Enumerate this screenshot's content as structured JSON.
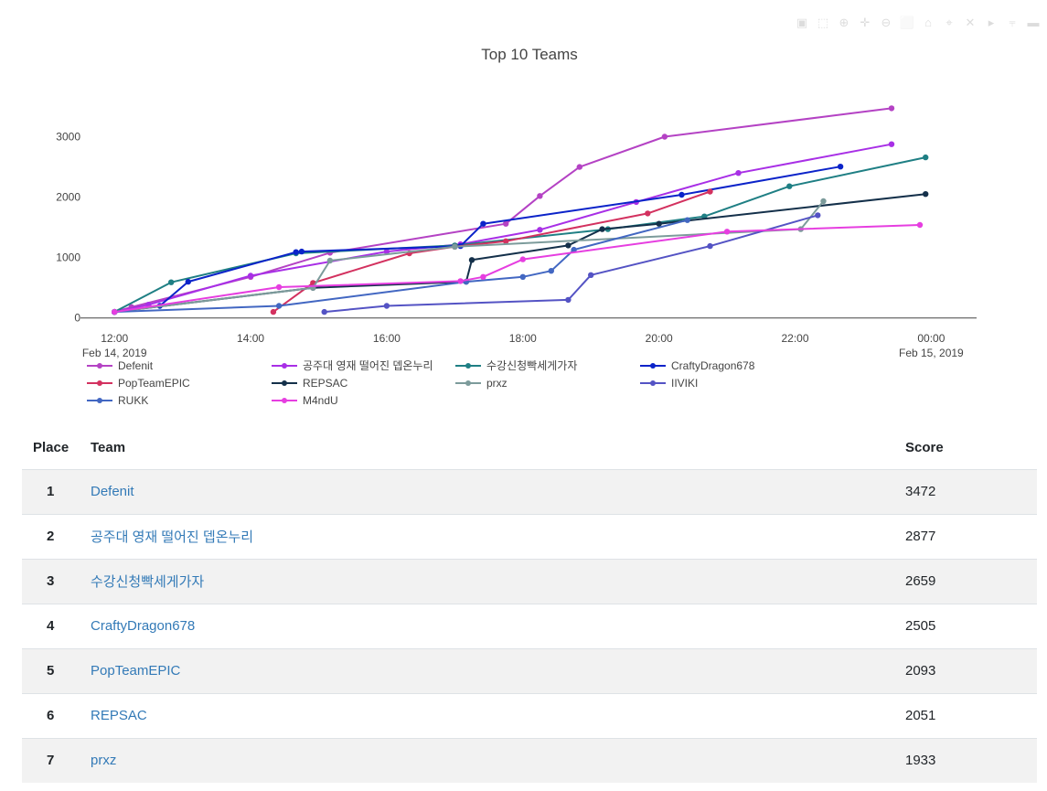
{
  "modebar": {
    "icons": [
      "camera-icon",
      "zoom-icon",
      "zoom-in-icon",
      "pan-icon",
      "zoom-out-icon",
      "autoscale-icon",
      "reset-axes-icon",
      "home-icon",
      "spike-icon",
      "hover-closest-icon",
      "hover-compare-icon",
      "plotly-logo-icon"
    ]
  },
  "chart_data": {
    "type": "line",
    "title": "Top 10 Teams",
    "xlabel": "",
    "ylabel": "",
    "x_type": "datetime",
    "x_range": [
      "2019-02-14 11:30",
      "2019-02-15 00:40"
    ],
    "ylim": [
      -80,
      3750
    ],
    "grid": false,
    "legend_position": "bottom",
    "x_ticks": [
      {
        "t": "2019-02-14 12:00",
        "line1": "12:00",
        "line2": "Feb 14, 2019"
      },
      {
        "t": "2019-02-14 14:00",
        "line1": "14:00",
        "line2": ""
      },
      {
        "t": "2019-02-14 16:00",
        "line1": "16:00",
        "line2": ""
      },
      {
        "t": "2019-02-14 18:00",
        "line1": "18:00",
        "line2": ""
      },
      {
        "t": "2019-02-14 20:00",
        "line1": "20:00",
        "line2": ""
      },
      {
        "t": "2019-02-14 22:00",
        "line1": "22:00",
        "line2": ""
      },
      {
        "t": "2019-02-15 00:00",
        "line1": "00:00",
        "line2": "Feb 15, 2019"
      }
    ],
    "y_ticks": [
      0,
      1000,
      2000,
      3000
    ],
    "series": [
      {
        "name": "Defenit",
        "color": "#b442c4",
        "points": [
          [
            "2019-02-14 12:00",
            100
          ],
          [
            "2019-02-14 12:15",
            180
          ],
          [
            "2019-02-14 14:00",
            680
          ],
          [
            "2019-02-14 15:10",
            1080
          ],
          [
            "2019-02-14 17:45",
            1560
          ],
          [
            "2019-02-14 18:15",
            2020
          ],
          [
            "2019-02-14 18:50",
            2500
          ],
          [
            "2019-02-14 20:05",
            3000
          ],
          [
            "2019-02-14 23:25",
            3472
          ]
        ]
      },
      {
        "name": "공주대 영재 떨어진 뎁온누리",
        "color": "#a82fe6",
        "points": [
          [
            "2019-02-14 12:00",
            100
          ],
          [
            "2019-02-14 12:30",
            220
          ],
          [
            "2019-02-14 14:00",
            700
          ],
          [
            "2019-02-14 16:00",
            1100
          ],
          [
            "2019-02-14 17:05",
            1220
          ],
          [
            "2019-02-14 18:15",
            1460
          ],
          [
            "2019-02-14 19:40",
            1920
          ],
          [
            "2019-02-14 21:10",
            2400
          ],
          [
            "2019-02-14 23:25",
            2877
          ]
        ]
      },
      {
        "name": "수강신청빡세게가자",
        "color": "#1f7f84",
        "points": [
          [
            "2019-02-14 12:00",
            100
          ],
          [
            "2019-02-14 12:50",
            590
          ],
          [
            "2019-02-14 14:40",
            1070
          ],
          [
            "2019-02-14 17:00",
            1200
          ],
          [
            "2019-02-14 19:15",
            1470
          ],
          [
            "2019-02-14 20:40",
            1680
          ],
          [
            "2019-02-14 21:55",
            2180
          ],
          [
            "2019-02-14 23:55",
            2659
          ]
        ]
      },
      {
        "name": "CraftyDragon678",
        "color": "#0b23c9",
        "points": [
          [
            "2019-02-14 12:00",
            100
          ],
          [
            "2019-02-14 12:40",
            200
          ],
          [
            "2019-02-14 13:05",
            600
          ],
          [
            "2019-02-14 14:40",
            1090
          ],
          [
            "2019-02-14 14:45",
            1100
          ],
          [
            "2019-02-14 17:05",
            1190
          ],
          [
            "2019-02-14 17:25",
            1560
          ],
          [
            "2019-02-14 20:20",
            2040
          ],
          [
            "2019-02-14 22:40",
            2505
          ]
        ]
      },
      {
        "name": "PopTeamEPIC",
        "color": "#d3315f",
        "points": [
          [
            "2019-02-14 14:20",
            100
          ],
          [
            "2019-02-14 14:55",
            580
          ],
          [
            "2019-02-14 16:20",
            1070
          ],
          [
            "2019-02-14 17:00",
            1180
          ],
          [
            "2019-02-14 17:45",
            1270
          ],
          [
            "2019-02-14 19:50",
            1730
          ],
          [
            "2019-02-14 20:45",
            2093
          ]
        ]
      },
      {
        "name": "REPSAC",
        "color": "#14304a",
        "points": [
          [
            "2019-02-14 12:00",
            100
          ],
          [
            "2019-02-14 14:55",
            500
          ],
          [
            "2019-02-14 17:10",
            600
          ],
          [
            "2019-02-14 17:15",
            960
          ],
          [
            "2019-02-14 18:40",
            1200
          ],
          [
            "2019-02-14 19:10",
            1470
          ],
          [
            "2019-02-14 20:00",
            1560
          ],
          [
            "2019-02-14 23:55",
            2051
          ]
        ]
      },
      {
        "name": "prxz",
        "color": "#7c9b9b",
        "points": [
          [
            "2019-02-14 12:00",
            100
          ],
          [
            "2019-02-14 14:55",
            500
          ],
          [
            "2019-02-14 15:10",
            950
          ],
          [
            "2019-02-14 17:00",
            1180
          ],
          [
            "2019-02-14 22:05",
            1470
          ],
          [
            "2019-02-14 22:25",
            1933
          ]
        ]
      },
      {
        "name": "IIVIKI",
        "color": "#5453c4",
        "points": [
          [
            "2019-02-14 15:05",
            100
          ],
          [
            "2019-02-14 16:00",
            200
          ],
          [
            "2019-02-14 18:40",
            300
          ],
          [
            "2019-02-14 19:00",
            710
          ],
          [
            "2019-02-14 20:45",
            1190
          ],
          [
            "2019-02-14 22:20",
            1700
          ]
        ]
      },
      {
        "name": "RUKK",
        "color": "#4267c2",
        "points": [
          [
            "2019-02-14 12:00",
            100
          ],
          [
            "2019-02-14 14:25",
            200
          ],
          [
            "2019-02-14 17:10",
            600
          ],
          [
            "2019-02-14 18:00",
            680
          ],
          [
            "2019-02-14 18:25",
            780
          ],
          [
            "2019-02-14 18:45",
            1130
          ],
          [
            "2019-02-14 20:25",
            1620
          ]
        ]
      },
      {
        "name": "M4ndU",
        "color": "#e63ee0",
        "points": [
          [
            "2019-02-14 12:00",
            100
          ],
          [
            "2019-02-14 14:25",
            510
          ],
          [
            "2019-02-14 17:05",
            610
          ],
          [
            "2019-02-14 17:25",
            680
          ],
          [
            "2019-02-14 18:00",
            970
          ],
          [
            "2019-02-14 21:00",
            1430
          ],
          [
            "2019-02-14 23:50",
            1540
          ]
        ]
      }
    ]
  },
  "table": {
    "headers": {
      "place": "Place",
      "team": "Team",
      "score": "Score"
    },
    "rows": [
      {
        "place": "1",
        "team": "Defenit",
        "score": "3472"
      },
      {
        "place": "2",
        "team": "공주대 영재 떨어진 뎁온누리",
        "score": "2877"
      },
      {
        "place": "3",
        "team": "수강신청빡세게가자",
        "score": "2659"
      },
      {
        "place": "4",
        "team": "CraftyDragon678",
        "score": "2505"
      },
      {
        "place": "5",
        "team": "PopTeamEPIC",
        "score": "2093"
      },
      {
        "place": "6",
        "team": "REPSAC",
        "score": "2051"
      },
      {
        "place": "7",
        "team": "prxz",
        "score": "1933"
      }
    ]
  }
}
